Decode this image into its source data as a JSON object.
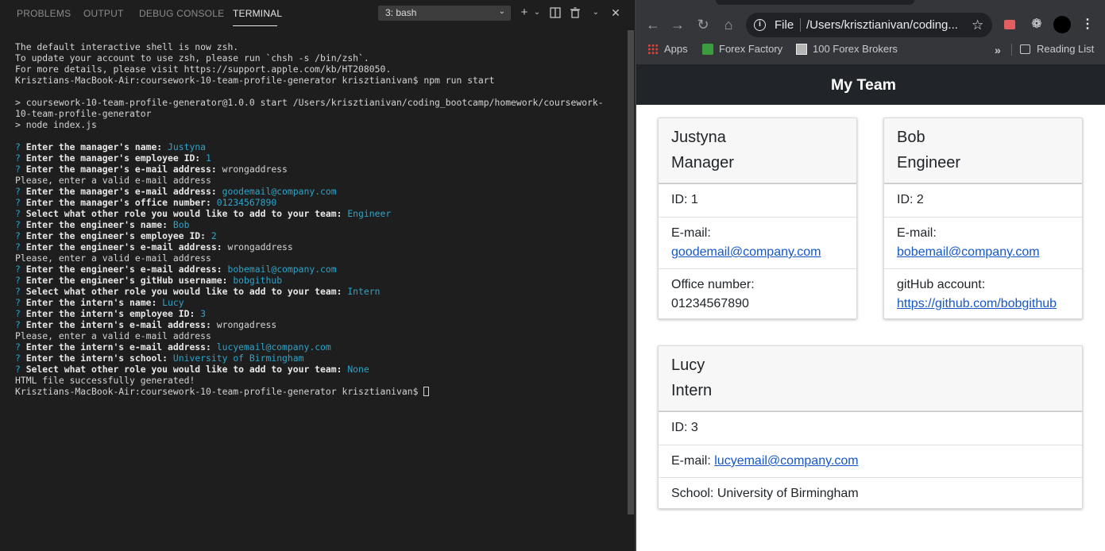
{
  "vscode": {
    "tabs": [
      "PROBLEMS",
      "OUTPUT",
      "DEBUG CONSOLE",
      "TERMINAL"
    ],
    "active_tab": "TERMINAL",
    "terminal_select": "3: bash",
    "icons": [
      "plus-icon",
      "chevron-down-icon",
      "split-icon",
      "trash-icon",
      "chevron-up-icon",
      "close-icon"
    ],
    "terminal_lines": [
      [
        {
          "t": "The default interactive shell is now zsh.",
          "c": ""
        }
      ],
      [
        {
          "t": "To update your account to use zsh, please run `chsh -s /bin/zsh`.",
          "c": ""
        }
      ],
      [
        {
          "t": "For more details, please visit https://support.apple.com/kb/HT208050.",
          "c": ""
        }
      ],
      [
        {
          "t": "Krisztians-MacBook-Air:coursework-10-team-profile-generator krisztianivan$ npm run start",
          "c": ""
        }
      ],
      [
        {
          "t": "",
          "c": ""
        }
      ],
      [
        {
          "t": "> coursework-10-team-profile-generator@1.0.0 start /Users/krisztianivan/coding_bootcamp/homework/coursework-",
          "c": ""
        }
      ],
      [
        {
          "t": "10-team-profile-generator",
          "c": ""
        }
      ],
      [
        {
          "t": "> node index.js",
          "c": ""
        }
      ],
      [
        {
          "t": "",
          "c": ""
        }
      ],
      [
        {
          "t": "? ",
          "c": "q"
        },
        {
          "t": "Enter the manager's name: ",
          "c": "b"
        },
        {
          "t": "Justyna",
          "c": "a"
        }
      ],
      [
        {
          "t": "? ",
          "c": "q"
        },
        {
          "t": "Enter the manager's employee ID: ",
          "c": "b"
        },
        {
          "t": "1",
          "c": "a"
        }
      ],
      [
        {
          "t": "? ",
          "c": "q"
        },
        {
          "t": "Enter the manager's e-mail address: ",
          "c": "b"
        },
        {
          "t": "wrongaddress",
          "c": ""
        }
      ],
      [
        {
          "t": "Please, enter a valid e-mail address",
          "c": ""
        }
      ],
      [
        {
          "t": "? ",
          "c": "q"
        },
        {
          "t": "Enter the manager's e-mail address: ",
          "c": "b"
        },
        {
          "t": "goodemail@company.com",
          "c": "a"
        }
      ],
      [
        {
          "t": "? ",
          "c": "q"
        },
        {
          "t": "Enter the manager's office number: ",
          "c": "b"
        },
        {
          "t": "01234567890",
          "c": "a"
        }
      ],
      [
        {
          "t": "? ",
          "c": "q"
        },
        {
          "t": "Select what other role you would like to add to your team: ",
          "c": "b"
        },
        {
          "t": "Engineer",
          "c": "a"
        }
      ],
      [
        {
          "t": "? ",
          "c": "q"
        },
        {
          "t": "Enter the engineer's name: ",
          "c": "b"
        },
        {
          "t": "Bob",
          "c": "a"
        }
      ],
      [
        {
          "t": "? ",
          "c": "q"
        },
        {
          "t": "Enter the engineer's employee ID: ",
          "c": "b"
        },
        {
          "t": "2",
          "c": "a"
        }
      ],
      [
        {
          "t": "? ",
          "c": "q"
        },
        {
          "t": "Enter the engineer's e-mail address: ",
          "c": "b"
        },
        {
          "t": "wrongaddress",
          "c": ""
        }
      ],
      [
        {
          "t": "Please, enter a valid e-mail address",
          "c": ""
        }
      ],
      [
        {
          "t": "? ",
          "c": "q"
        },
        {
          "t": "Enter the engineer's e-mail address: ",
          "c": "b"
        },
        {
          "t": "bobemail@company.com",
          "c": "a"
        }
      ],
      [
        {
          "t": "? ",
          "c": "q"
        },
        {
          "t": "Enter the engineer's gitHub username: ",
          "c": "b"
        },
        {
          "t": "bobgithub",
          "c": "a"
        }
      ],
      [
        {
          "t": "? ",
          "c": "q"
        },
        {
          "t": "Select what other role you would like to add to your team: ",
          "c": "b"
        },
        {
          "t": "Intern",
          "c": "a"
        }
      ],
      [
        {
          "t": "? ",
          "c": "q"
        },
        {
          "t": "Enter the intern's name: ",
          "c": "b"
        },
        {
          "t": "Lucy",
          "c": "a"
        }
      ],
      [
        {
          "t": "? ",
          "c": "q"
        },
        {
          "t": "Enter the intern's employee ID: ",
          "c": "b"
        },
        {
          "t": "3",
          "c": "a"
        }
      ],
      [
        {
          "t": "? ",
          "c": "q"
        },
        {
          "t": "Enter the intern's e-mail address: ",
          "c": "b"
        },
        {
          "t": "wrongadress",
          "c": ""
        }
      ],
      [
        {
          "t": "Please, enter a valid e-mail address",
          "c": ""
        }
      ],
      [
        {
          "t": "? ",
          "c": "q"
        },
        {
          "t": "Enter the intern's e-mail address: ",
          "c": "b"
        },
        {
          "t": "lucyemail@company.com",
          "c": "a"
        }
      ],
      [
        {
          "t": "? ",
          "c": "q"
        },
        {
          "t": "Enter the intern's school: ",
          "c": "b"
        },
        {
          "t": "University of Birmingham",
          "c": "a"
        }
      ],
      [
        {
          "t": "? ",
          "c": "q"
        },
        {
          "t": "Select what other role you would like to add to your team: ",
          "c": "b"
        },
        {
          "t": "None",
          "c": "a"
        }
      ],
      [
        {
          "t": "HTML file successfully generated!",
          "c": ""
        }
      ],
      [
        {
          "t": "Krisztians-MacBook-Air:coursework-10-team-profile-generator krisztianivan$ ",
          "c": ""
        }
      ]
    ]
  },
  "browser": {
    "omnibox_protocol": "File",
    "omnibox_url": "/Users/krisztianivan/coding...",
    "bookmarks": [
      "Apps",
      "Forex Factory",
      "100 Forex Brokers"
    ],
    "reading_list": "Reading List",
    "page_title": "My Team",
    "cards": [
      {
        "name": "Justyna",
        "role": "Manager",
        "id": "ID: 1",
        "email_label": "E-mail:",
        "email": "goodemail@company.com",
        "extra_label": "Office number:",
        "extra_value": "01234567890",
        "extra_is_link": false
      },
      {
        "name": "Bob",
        "role": "Engineer",
        "id": "ID: 2",
        "email_label": "E-mail:",
        "email": "bobemail@company.com",
        "extra_label": "gitHub account:",
        "extra_value": "https://github.com/bobgithub",
        "extra_is_link": true
      },
      {
        "name": "Lucy",
        "role": "Intern",
        "id": "ID: 3",
        "email_label": "E-mail:",
        "email": "lucyemail@company.com",
        "extra_label": "School:",
        "extra_value": "University of Birmingham",
        "extra_is_link": false
      }
    ]
  },
  "colors": {
    "terminal_bg": "#1e1e1e",
    "prompt_accent": "#2da4c9",
    "link": "#1557c9",
    "jumbotron": "#212529"
  }
}
